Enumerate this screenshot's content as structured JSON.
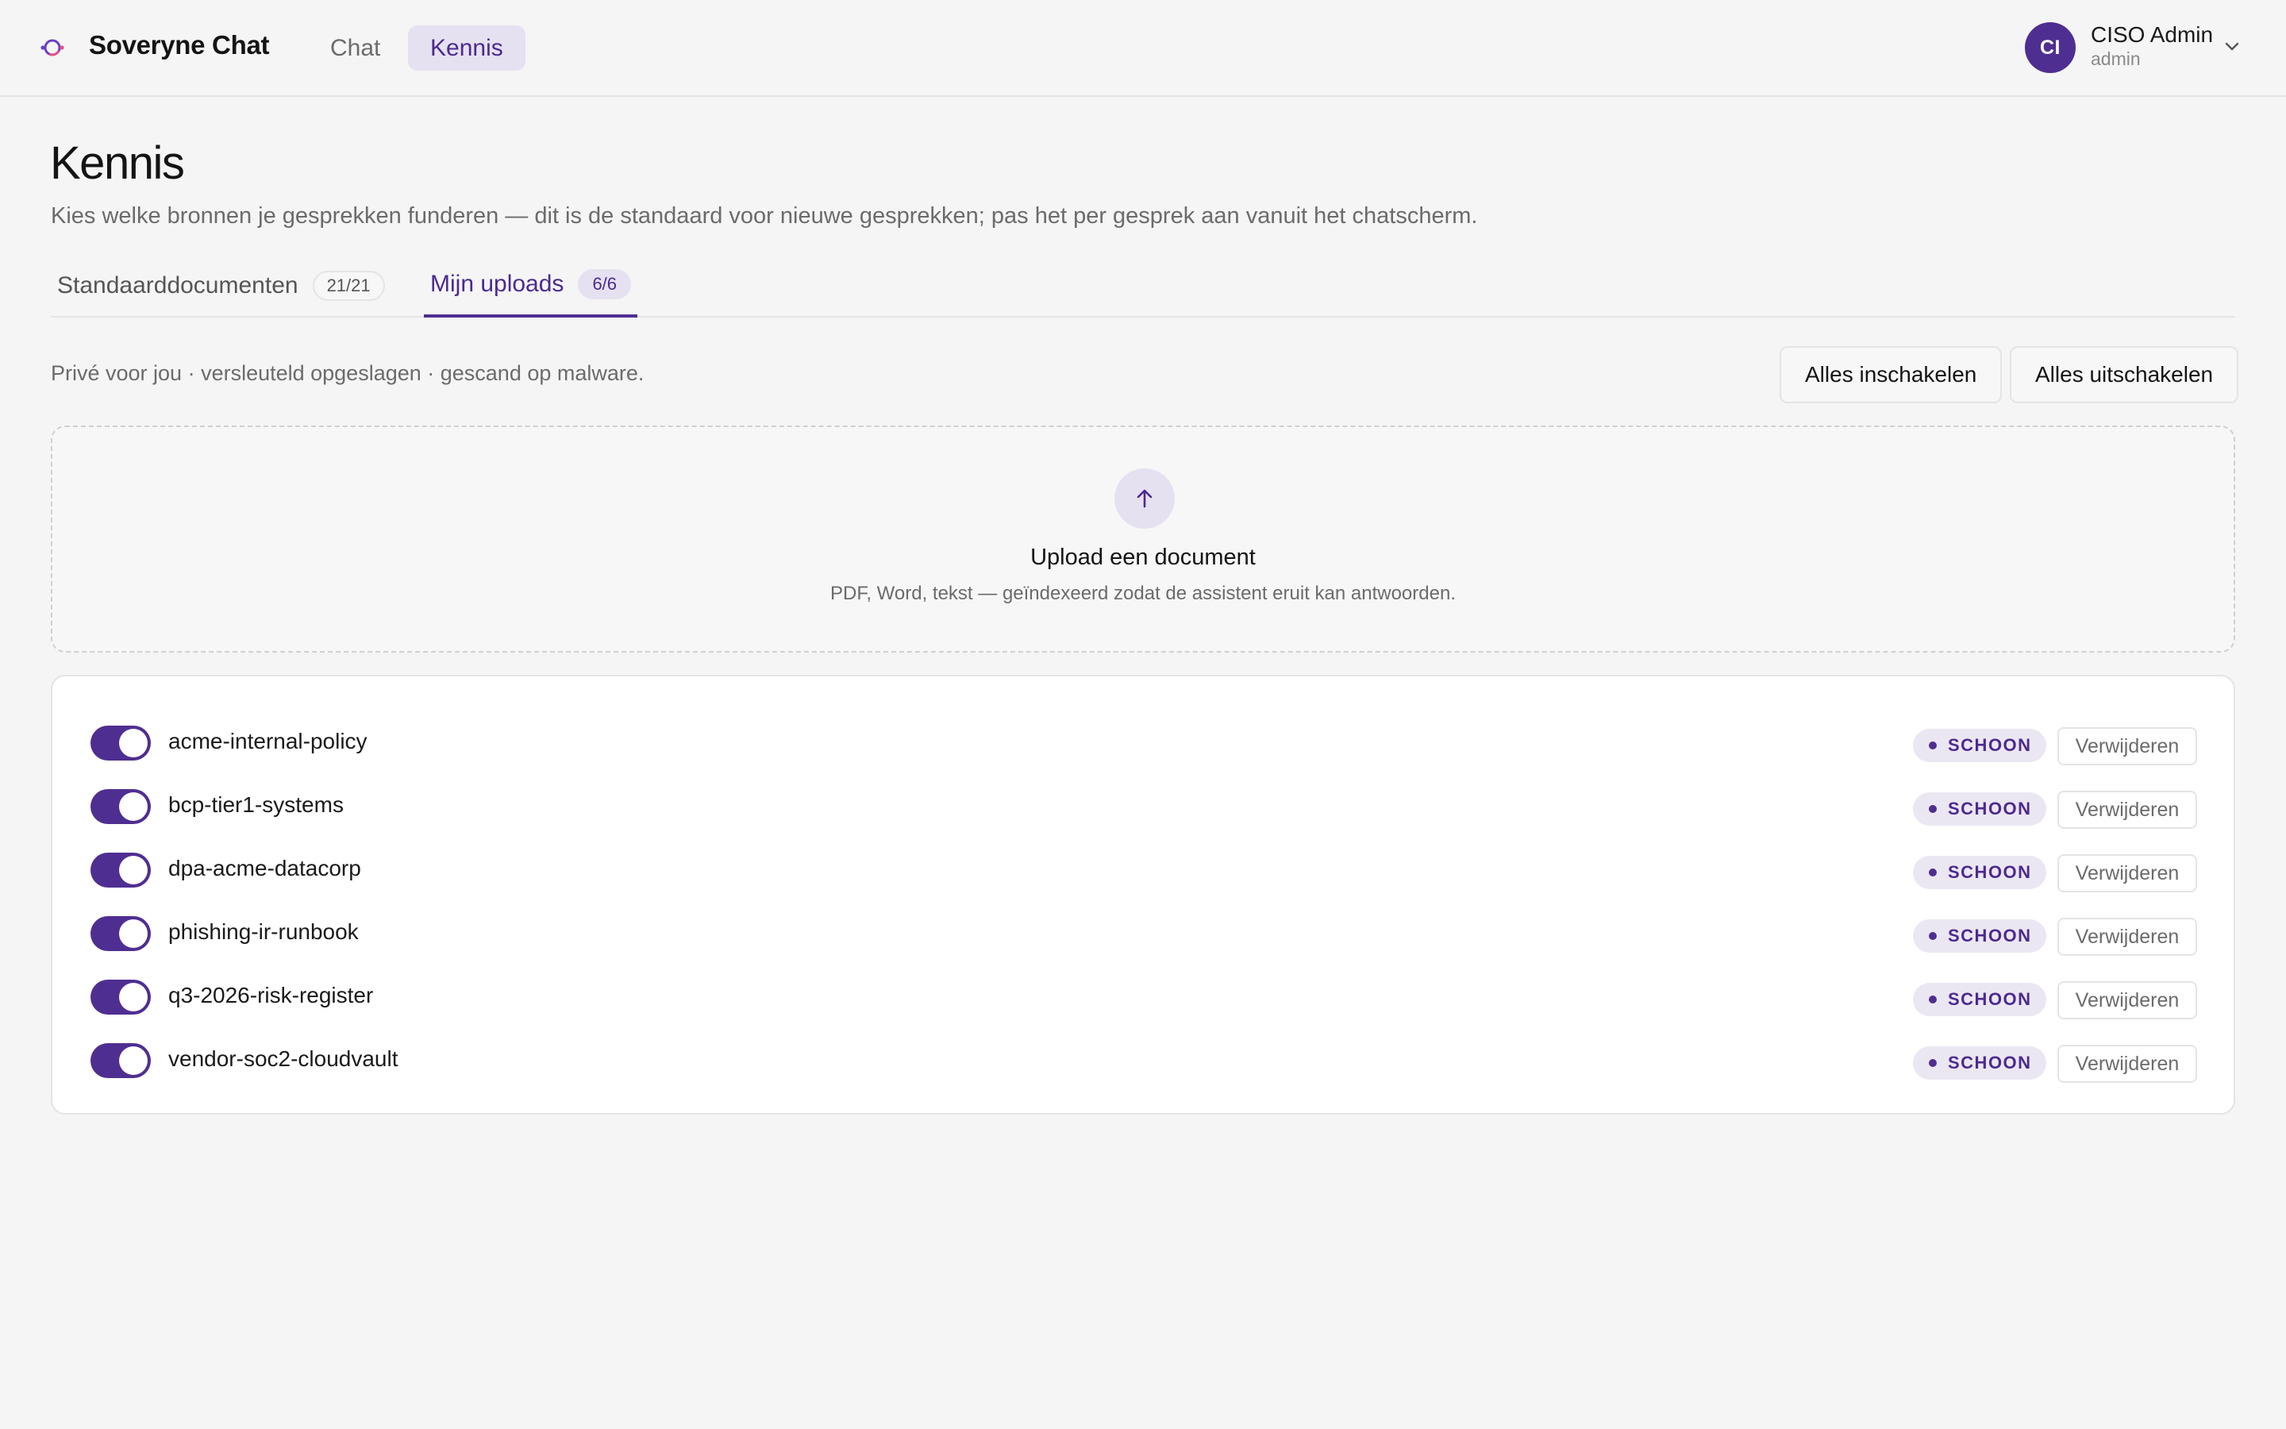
{
  "header": {
    "brand": "Soveryne Chat",
    "logo_icon": "orbit-logo-icon",
    "nav": [
      {
        "label": "Chat",
        "active": false
      },
      {
        "label": "Kennis",
        "active": true
      }
    ],
    "user": {
      "initials": "CI",
      "name": "CISO Admin",
      "role": "admin"
    }
  },
  "page": {
    "title": "Kennis",
    "subtitle": "Kies welke bronnen je gesprekken funderen — dit is de standaard voor nieuwe gesprekken; pas het per gesprek aan vanuit het chatscherm."
  },
  "tabs": [
    {
      "label": "Standaarddocumenten",
      "count": "21/21",
      "active": false
    },
    {
      "label": "Mijn uploads",
      "count": "6/6",
      "active": true
    }
  ],
  "toolbar": {
    "privacy_note": "Privé voor jou · versleuteld opgeslagen · gescand op malware.",
    "enable_all": "Alles inschakelen",
    "disable_all": "Alles uitschakelen"
  },
  "upload": {
    "title": "Upload een document",
    "subtitle": "PDF, Word, tekst — geïndexeerd zodat de assistent eruit kan antwoorden."
  },
  "documents": [
    {
      "name": "acme-internal-policy",
      "enabled": true,
      "status": "SCHOON",
      "delete_label": "Verwijderen"
    },
    {
      "name": "bcp-tier1-systems",
      "enabled": true,
      "status": "SCHOON",
      "delete_label": "Verwijderen"
    },
    {
      "name": "dpa-acme-datacorp",
      "enabled": true,
      "status": "SCHOON",
      "delete_label": "Verwijderen"
    },
    {
      "name": "phishing-ir-runbook",
      "enabled": true,
      "status": "SCHOON",
      "delete_label": "Verwijderen"
    },
    {
      "name": "q3-2026-risk-register",
      "enabled": true,
      "status": "SCHOON",
      "delete_label": "Verwijderen"
    },
    {
      "name": "vendor-soc2-cloudvault",
      "enabled": true,
      "status": "SCHOON",
      "delete_label": "Verwijderen"
    }
  ],
  "colors": {
    "accent": "#4f2e91",
    "accent_soft": "#e6e1f0",
    "background": "#f5f5f5"
  }
}
